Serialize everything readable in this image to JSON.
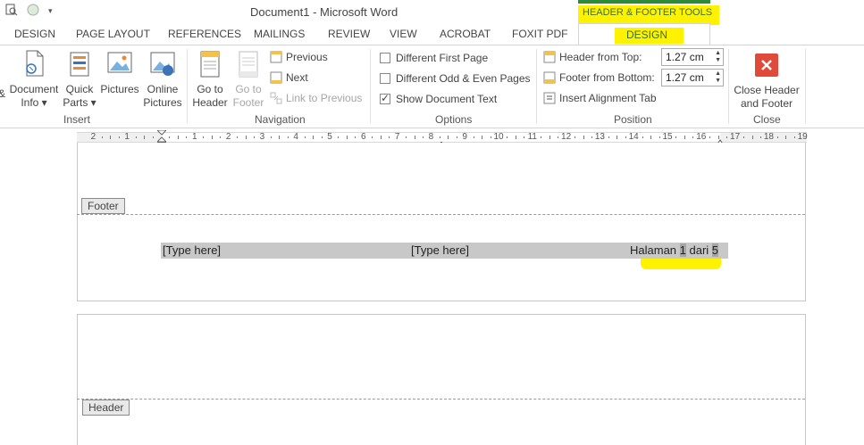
{
  "window": {
    "title": "Document1 - Microsoft Word",
    "context_group": "HEADER & FOOTER TOOLS"
  },
  "tabs": [
    "DESIGN",
    "PAGE LAYOUT",
    "REFERENCES",
    "MAILINGS",
    "REVIEW",
    "VIEW",
    "ACROBAT",
    "FOXIT PDF"
  ],
  "active_tab": "DESIGN",
  "ribbon": {
    "insert": {
      "label": "Insert",
      "document_info": [
        "Document",
        "Info ▾"
      ],
      "quick_parts": [
        "Quick",
        "Parts ▾"
      ],
      "pictures": "Pictures",
      "online_pictures": [
        "Online",
        "Pictures"
      ]
    },
    "navigation": {
      "label": "Navigation",
      "go_to_header": [
        "Go to",
        "Header"
      ],
      "go_to_footer": [
        "Go to",
        "Footer"
      ],
      "previous": "Previous",
      "next": "Next",
      "link_to_previous": "Link to Previous"
    },
    "options": {
      "label": "Options",
      "different_first_page": "Different First Page",
      "different_odd_even": "Different Odd & Even Pages",
      "show_document_text": "Show Document Text"
    },
    "position": {
      "label": "Position",
      "header_from_top": "Header from Top:",
      "header_from_top_value": "1.27 cm",
      "footer_from_bottom": "Footer from Bottom:",
      "footer_from_bottom_value": "1.27 cm",
      "insert_alignment_tab": "Insert Alignment Tab"
    },
    "close": {
      "label": "Close",
      "close_header_footer": [
        "Close Header",
        "and Footer"
      ]
    }
  },
  "ruler": {
    "labels": [
      "2",
      "1",
      "1",
      "2",
      "3",
      "4",
      "5",
      "6",
      "7",
      "8",
      "9",
      "10",
      "11",
      "12",
      "13",
      "14",
      "15",
      "16",
      "17",
      "18",
      "19"
    ]
  },
  "document": {
    "footer_tag": "Footer",
    "header_tag": "Header",
    "footer_left": "[Type here]",
    "footer_center": "[Type here]",
    "footer_right_prefix": "Halaman ",
    "footer_page": "1",
    "footer_of": " dari ",
    "footer_total": "5"
  },
  "colors": {
    "highlight": "#fff200",
    "context_green": "#2e8b3a",
    "close_red": "#e04a3a"
  }
}
